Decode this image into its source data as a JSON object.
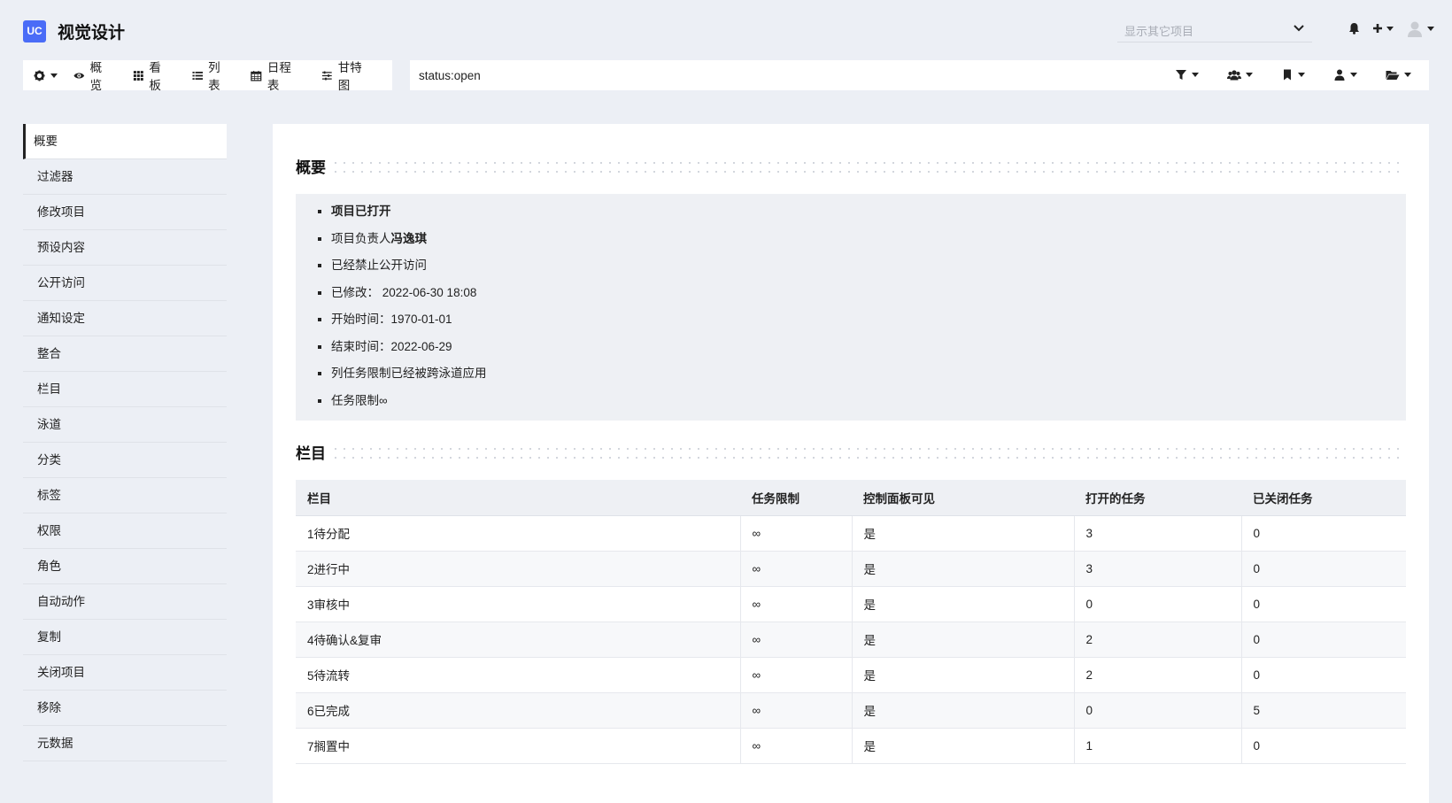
{
  "app": {
    "logo_text": "UC",
    "title": "视觉设计"
  },
  "header": {
    "project_select_placeholder": "显示其它项目",
    "icons": [
      "bell-icon",
      "plus-icon",
      "avatar"
    ]
  },
  "viewnav": {
    "items": [
      {
        "label": "概览",
        "icon": "eye-icon"
      },
      {
        "label": "看板",
        "icon": "grid-icon"
      },
      {
        "label": "列表",
        "icon": "list-icon"
      },
      {
        "label": "日程表",
        "icon": "calendar-icon"
      },
      {
        "label": "甘特图",
        "icon": "sliders-icon"
      }
    ]
  },
  "search": {
    "value": "status:open"
  },
  "sidebar": {
    "items": [
      {
        "label": "概要",
        "active": true
      },
      {
        "label": "过滤器"
      },
      {
        "label": "修改项目"
      },
      {
        "label": "预设内容"
      },
      {
        "label": "公开访问"
      },
      {
        "label": "通知设定"
      },
      {
        "label": "整合"
      },
      {
        "label": "栏目"
      },
      {
        "label": "泳道"
      },
      {
        "label": "分类"
      },
      {
        "label": "标签"
      },
      {
        "label": "权限"
      },
      {
        "label": "角色"
      },
      {
        "label": "自动动作"
      },
      {
        "label": "复制"
      },
      {
        "label": "关闭项目"
      },
      {
        "label": "移除"
      },
      {
        "label": "元数据"
      }
    ]
  },
  "summary": {
    "title": "概要",
    "open": "项目已打开",
    "owner_prefix": "项目负责人",
    "owner_name": "冯逸琪",
    "public": "已经禁止公开访问",
    "modified": "已修改： 2022-06-30 18:08",
    "start": "开始时间：1970-01-01",
    "end": "结束时间：2022-06-29",
    "column_limit": "列任务限制已经被跨泳道应用",
    "task_limit": "任务限制∞"
  },
  "columns": {
    "title": "栏目",
    "headers": [
      "栏目",
      "任务限制",
      "控制面板可见",
      "打开的任务",
      "已关闭任务"
    ],
    "rows": [
      [
        "1待分配",
        "∞",
        "是",
        "3",
        "0"
      ],
      [
        "2进行中",
        "∞",
        "是",
        "3",
        "0"
      ],
      [
        "3审核中",
        "∞",
        "是",
        "0",
        "0"
      ],
      [
        "4待确认&复审",
        "∞",
        "是",
        "2",
        "0"
      ],
      [
        "5待流转",
        "∞",
        "是",
        "2",
        "0"
      ],
      [
        "6已完成",
        "∞",
        "是",
        "0",
        "5"
      ],
      [
        "7搁置中",
        "∞",
        "是",
        "1",
        "0"
      ]
    ]
  }
}
